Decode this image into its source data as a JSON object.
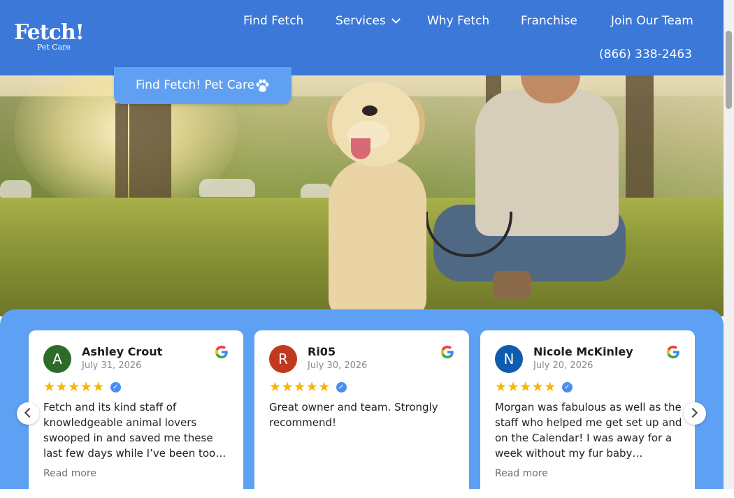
{
  "brand": {
    "logo_main": "Fetch!",
    "logo_sub": "Pet Care"
  },
  "nav": {
    "items": [
      {
        "label": "Find Fetch"
      },
      {
        "label": "Services",
        "has_dropdown": true
      },
      {
        "label": "Why Fetch"
      },
      {
        "label": "Franchise"
      },
      {
        "label": "Join Our Team"
      }
    ],
    "phone": "(866) 338-2463"
  },
  "hero": {
    "cta_label": "Find Fetch! Pet Care",
    "cta_icon": "paw-icon"
  },
  "reviews": [
    {
      "initial": "A",
      "name": "Ashley Crout",
      "date": "July 31, 2026",
      "avatar_color": "#2e6b2a",
      "rating": 5,
      "verified": true,
      "text": "Fetch and its kind staff of knowledgeable animal lovers swooped in and saved me these last few days while I’ve been too…",
      "read_more": "Read more"
    },
    {
      "initial": "R",
      "name": "Ri05",
      "date": "July 30, 2026",
      "avatar_color": "#c1391f",
      "rating": 5,
      "verified": true,
      "text": "Great owner and team. Strongly recommend!",
      "read_more": ""
    },
    {
      "initial": "N",
      "name": "Nicole McKinley",
      "date": "July 20, 2026",
      "avatar_color": "#0f5bae",
      "rating": 5,
      "verified": true,
      "text": "Morgan was fabulous as well as the staff who helped me get set up and on the Calendar! I was away for a week without my fur baby…",
      "read_more": "Read more"
    }
  ],
  "colors": {
    "header": "#3b78d8",
    "panel": "#5ea1f4",
    "cta": "#5fa0f3",
    "star": "#f6b602"
  }
}
